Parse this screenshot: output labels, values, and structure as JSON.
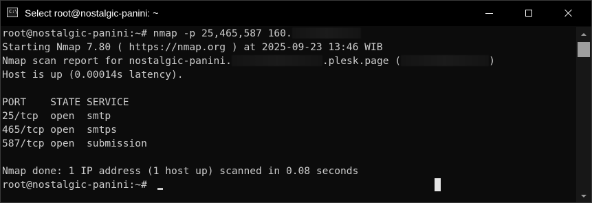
{
  "window": {
    "title": "Select root@nostalgic-panini: ~",
    "icon": "terminal-icon",
    "icon_prompt": "C:\\",
    "controls": [
      "minimize-icon",
      "maximize-icon",
      "close-icon"
    ]
  },
  "terminal": {
    "lines": [
      {
        "text": "root@nostalgic-panini:~# nmap -p 25,465,587 160.",
        "tail": ""
      },
      {
        "text": "Starting Nmap 7.80 ( https://nmap.org ) at 2025-09-23 13:46 WIB"
      },
      {
        "text": "Nmap scan report for nostalgic-panini.",
        "mid": ".plesk.page (",
        "end": ")"
      },
      {
        "text": "Host is up (0.00014s latency)."
      },
      {
        "text": ""
      },
      {
        "text": "PORT    STATE SERVICE"
      },
      {
        "text": "25/tcp  open  smtp"
      },
      {
        "text": "465/tcp open  smtps"
      },
      {
        "text": "587/tcp open  submission"
      },
      {
        "text": ""
      },
      {
        "text": "Nmap done: 1 IP address (1 host up) scanned in 0.08 seconds"
      },
      {
        "text": "root@nostalgic-panini:~# "
      }
    ]
  },
  "colors": {
    "background": "#0c0c0c",
    "foreground": "#cccccc",
    "titlebar": "#000000"
  }
}
